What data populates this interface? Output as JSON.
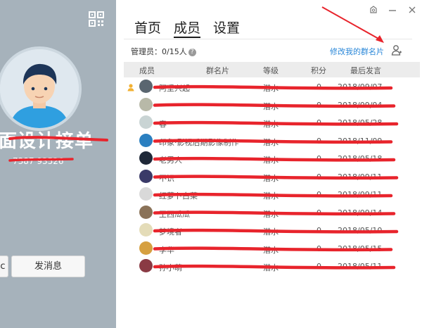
{
  "profile": {
    "group_name": "面设计接单",
    "group_id": "7387 93526",
    "left_button_label": "c",
    "send_message_label": "发消息"
  },
  "tabs": [
    {
      "label": "首页",
      "active": false
    },
    {
      "label": "成员",
      "active": true
    },
    {
      "label": "设置",
      "active": false
    }
  ],
  "members_header": {
    "admin_count": "管理员：0/15人",
    "help_icon": "?",
    "edit_card_link": "修改我的群名片"
  },
  "columns": [
    "成员",
    "群名片",
    "等级",
    "积分",
    "最后发言"
  ],
  "members": [
    {
      "name": "阿坚兴起",
      "level": "潜水",
      "points": "0",
      "last": "2018/09/07",
      "owner": true,
      "avatar_color": "#5a6670"
    },
    {
      "name": "",
      "level": "潜水",
      "points": "0",
      "last": "2018/09/04",
      "owner": false,
      "avatar_color": "#b8b9a8"
    },
    {
      "name": "春",
      "level": "潜水",
      "points": "0",
      "last": "2018/05/28",
      "owner": false,
      "avatar_color": "#c9d4d4"
    },
    {
      "name": "印象·影视后期影像制作",
      "level": "潜水",
      "points": "0",
      "last": "2018/11/09",
      "owner": false,
      "avatar_color": "#2a7fc0"
    },
    {
      "name": "老男人",
      "level": "潜水",
      "points": "0",
      "last": "2018/05/18",
      "owner": false,
      "avatar_color": "#1f2838"
    },
    {
      "name": "不识",
      "level": "潜水",
      "points": "0",
      "last": "2018/09/11",
      "owner": false,
      "avatar_color": "#3a3a68"
    },
    {
      "name": "红萝卜白菜",
      "level": "潜水",
      "points": "0",
      "last": "2018/09/11",
      "owner": false,
      "avatar_color": "#d9d9d9"
    },
    {
      "name": "王西瓜瓜",
      "level": "潜水",
      "points": "0",
      "last": "2018/09/14",
      "owner": false,
      "avatar_color": "#8a7258"
    },
    {
      "name": "梦境者",
      "level": "潜水",
      "points": "0",
      "last": "2018/05/10",
      "owner": false,
      "avatar_color": "#e4dcb8"
    },
    {
      "name": "李华",
      "level": "潜水",
      "points": "0",
      "last": "2018/05/15",
      "owner": false,
      "avatar_color": "#d6a040"
    },
    {
      "name": "孙小萌",
      "level": "潜水",
      "points": "0",
      "last": "2018/05/11",
      "owner": false,
      "avatar_color": "#8a3a44"
    }
  ],
  "colors": {
    "panel_bg": "#a6b2bb",
    "link": "#2a87d8",
    "annotation_red": "#e8242c"
  },
  "icons": [
    "qr-code-icon",
    "skin-icon",
    "minimize-icon",
    "close-icon",
    "help-icon",
    "member-card-icon",
    "owner-crown-icon"
  ]
}
